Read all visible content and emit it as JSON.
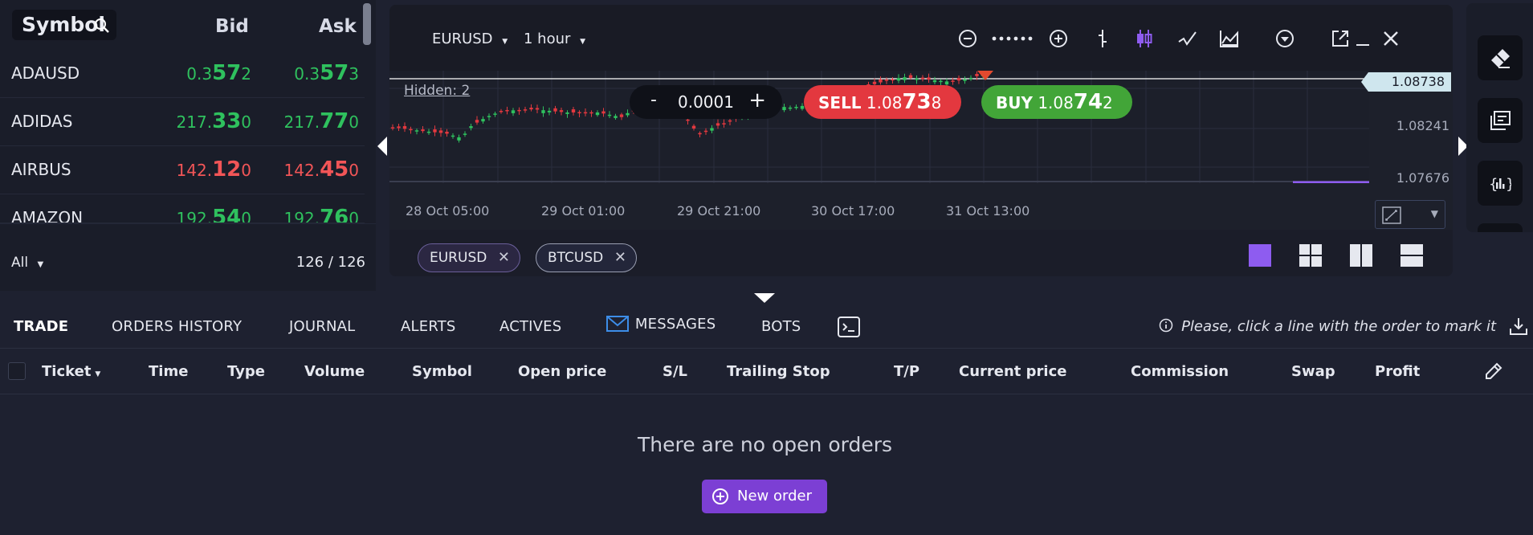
{
  "symbols": {
    "title": "Symbol",
    "col_bid": "Bid",
    "col_ask": "Ask",
    "rows": [
      {
        "name": "ADAUSD",
        "bid_pre": "0.3",
        "bid_big": "57",
        "bid_sup": "2",
        "ask_pre": "0.3",
        "ask_big": "57",
        "ask_sup": "3"
      },
      {
        "name": "ADIDAS",
        "bid_pre": "217.",
        "bid_big": "33",
        "bid_sup": "0",
        "ask_pre": "217.",
        "ask_big": "77",
        "ask_sup": "0"
      },
      {
        "name": "AIRBUS",
        "bid_pre": "142.",
        "bid_big": "12",
        "bid_sup": "0",
        "ask_pre": "142.",
        "ask_big": "45",
        "ask_sup": "0"
      },
      {
        "name": "AMAZON",
        "bid_pre": "192.",
        "bid_big": "54",
        "bid_sup": "0",
        "ask_pre": "192.",
        "ask_big": "76",
        "ask_sup": "0"
      }
    ],
    "filter": "All",
    "count": "126 / 126"
  },
  "chart": {
    "symbol": "EURUSD",
    "timeframe": "1 hour",
    "hidden": "Hidden: 2",
    "prices": [
      "1.08738",
      "1.08241",
      "1.07676"
    ],
    "dates": [
      "28 Oct 05:00",
      "29 Oct 01:00",
      "29 Oct 21:00",
      "30 Oct 17:00",
      "31 Oct 13:00"
    ],
    "quantity": {
      "minus": "-",
      "value": "0.0001",
      "plus": "+"
    },
    "sell": {
      "label": "SELL",
      "pre": "1.08",
      "big": "73",
      "sup": "8"
    },
    "buy": {
      "label": "BUY",
      "pre": "1.08",
      "big": "74",
      "sup": "2"
    },
    "tabs": [
      {
        "label": "EURUSD"
      },
      {
        "label": "BTCUSD"
      }
    ],
    "colors": {
      "up": "#2fc15e",
      "down": "#e3383f",
      "accent": "#8e5cf0"
    }
  },
  "bottom": {
    "tabs": [
      "TRADE",
      "ORDERS HISTORY",
      "JOURNAL",
      "ALERTS",
      "ACTIVES",
      "MESSAGES",
      "BOTS"
    ],
    "hint": "Please, click a line with the order to mark it",
    "columns": [
      "Ticket",
      "Time",
      "Type",
      "Volume",
      "Symbol",
      "Open price",
      "S/L",
      "Trailing Stop",
      "T/P",
      "Current price",
      "Commission",
      "Swap",
      "Profit"
    ],
    "empty_message": "There are no open orders",
    "new_order": "New order"
  }
}
